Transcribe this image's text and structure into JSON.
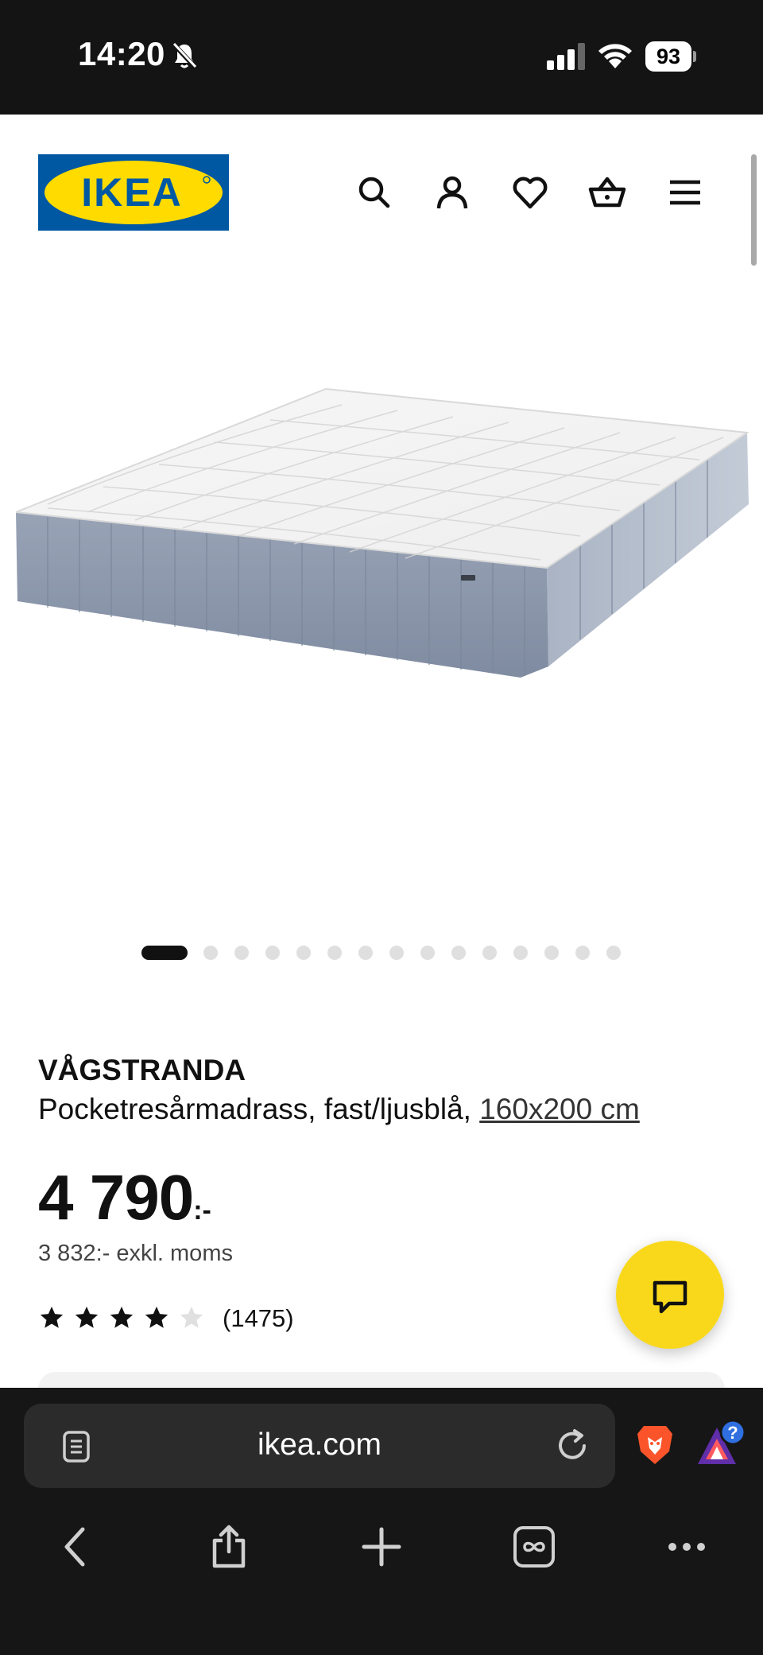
{
  "status_bar": {
    "time": "14:20",
    "battery": "93"
  },
  "header": {
    "logo_text": "IKEA",
    "icons": [
      "search-icon",
      "account-icon",
      "heart-icon",
      "basket-icon",
      "menu-icon"
    ]
  },
  "carousel": {
    "total_images": 15,
    "active_index": 0
  },
  "product": {
    "name": "VÅGSTRANDA",
    "description": "Pocketresårmadrass, fast/ljusblå,",
    "size_link": "160x200 cm",
    "price_integer": "4 790",
    "price_suffix": ":-",
    "price_exkl": "3 832:- exkl. moms",
    "rating": 4,
    "rating_max": 5,
    "review_count": "(1475)"
  },
  "browser": {
    "url": "ikea.com"
  },
  "colors": {
    "ikea_blue": "#0058a3",
    "ikea_yellow": "#ffdb00",
    "chat_yellow": "#f9d81c",
    "status_bg": "#141414"
  }
}
